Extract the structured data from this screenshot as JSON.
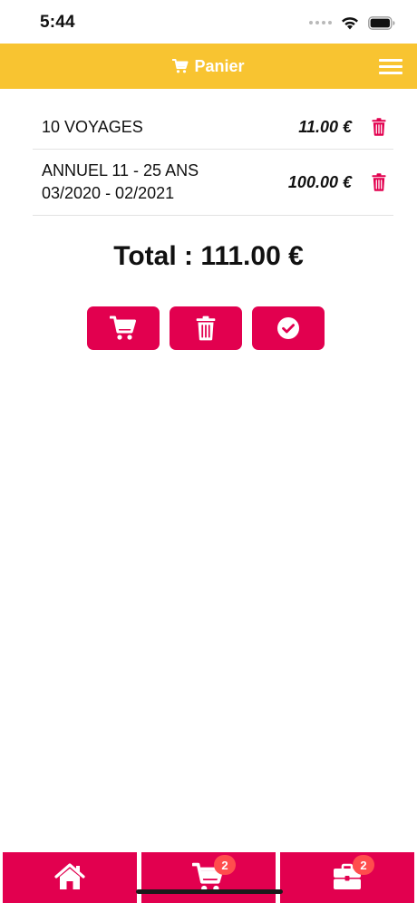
{
  "status_bar": {
    "time": "5:44"
  },
  "header": {
    "title": "Panier",
    "title_icon": "cart-icon",
    "menu_icon": "hamburger-menu-icon",
    "background_color": "#f8c431"
  },
  "cart": {
    "items": [
      {
        "label_lines": [
          "10 VOYAGES"
        ],
        "price": "11.00 €",
        "delete_icon": "trash-icon"
      },
      {
        "label_lines": [
          "ANNUEL 11 - 25 ANS",
          "03/2020 - 02/2021"
        ],
        "price": "100.00 €",
        "delete_icon": "trash-icon"
      }
    ],
    "total": "Total : 111.00 €"
  },
  "actions": [
    {
      "icon": "cart-icon"
    },
    {
      "icon": "trash-icon"
    },
    {
      "icon": "check-circle-icon"
    }
  ],
  "tab_bar": {
    "tabs": [
      {
        "icon": "home-icon",
        "badge": ""
      },
      {
        "icon": "cart-icon",
        "badge": "2"
      },
      {
        "icon": "briefcase-icon",
        "badge": "2"
      }
    ]
  },
  "colors": {
    "accent": "#e2004f",
    "header": "#f8c431",
    "badge": "#ff4d4d"
  }
}
